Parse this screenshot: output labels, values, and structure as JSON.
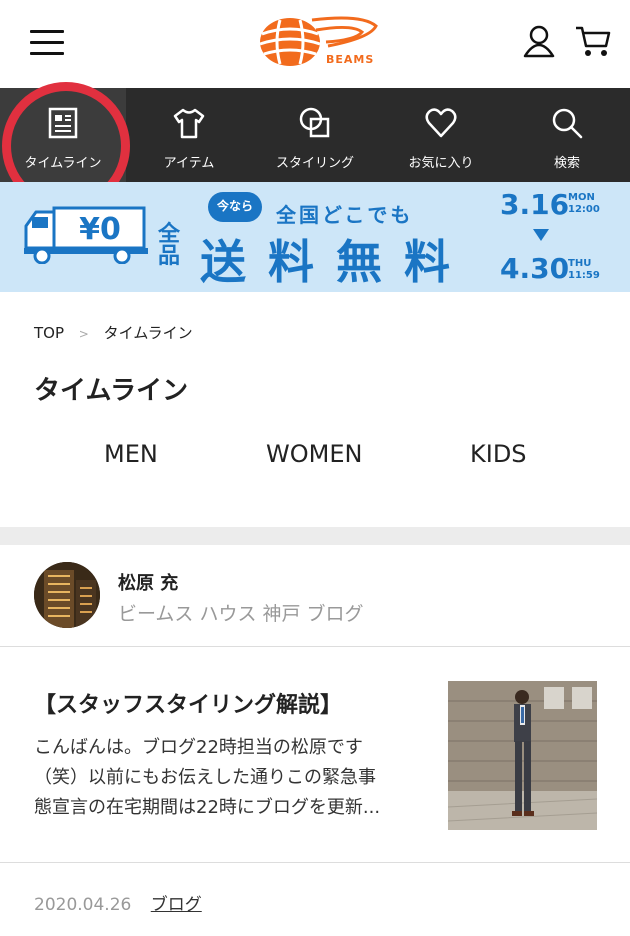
{
  "header": {
    "logo_text": "BEAMS",
    "brand_color": "#f26b1d"
  },
  "nav": {
    "items": [
      {
        "label": "タイムライン",
        "icon": "newspaper-icon"
      },
      {
        "label": "アイテム",
        "icon": "tshirt-icon"
      },
      {
        "label": "スタイリング",
        "icon": "styling-icon"
      },
      {
        "label": "お気に入り",
        "icon": "heart-icon"
      },
      {
        "label": "検索",
        "icon": "search-icon"
      }
    ]
  },
  "banner": {
    "price_tag": "¥0",
    "zen": "全品",
    "imanara": "今なら",
    "sub": "全国どこでも",
    "main": "送料無料",
    "start_date": "3.16",
    "start_day": "MON",
    "start_time": "12:00",
    "end_date": "4.30",
    "end_day": "THU",
    "end_time": "11:59",
    "accent": "#1a75c4"
  },
  "breadcrumb": {
    "home": "TOP",
    "current": "タイムライン"
  },
  "page_title": "タイムライン",
  "tabs": [
    "MEN",
    "WOMEN",
    "KIDS"
  ],
  "author": {
    "name": "松原 充",
    "shop": "ビームス ハウス 神戸 ブログ"
  },
  "post": {
    "title": "【スタッフスタイリング解説】",
    "excerpt_lines": [
      "こんばんは。ブログ22時担当の松原です",
      "（笑）以前にもお伝えした通りこの緊急事",
      "態宣言の在宅期間は22時にブログを更新..."
    ],
    "date": "2020.04.26",
    "category": "ブログ"
  }
}
